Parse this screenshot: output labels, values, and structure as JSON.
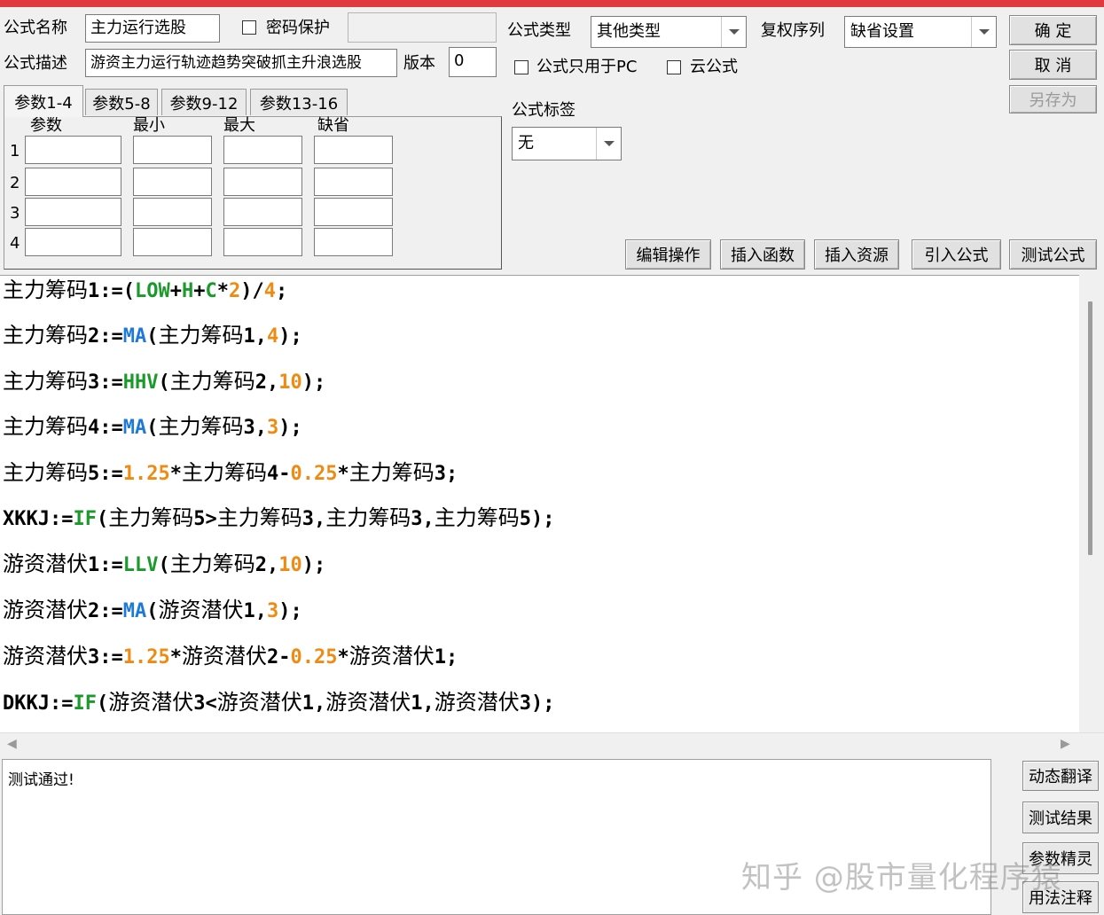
{
  "form": {
    "name_label": "公式名称",
    "name_value": "主力运行选股",
    "password_label": "密码保护",
    "desc_label": "公式描述",
    "desc_value": "游资主力运行轨迹趋势突破抓主升浪选股",
    "version_label": "版本",
    "version_value": "0",
    "type_label": "公式类型",
    "type_value": "其他类型",
    "rights_label": "复权序列",
    "rights_value": "缺省设置",
    "pc_only_label": "公式只用于PC",
    "cloud_label": "云公式",
    "tag_label": "公式标签",
    "tag_value": "无"
  },
  "buttons": {
    "ok": "确  定",
    "cancel": "取  消",
    "save_as": "另存为",
    "edit_ops": "编辑操作",
    "insert_func": "插入函数",
    "insert_res": "插入资源",
    "import_formula": "引入公式",
    "test_formula": "测试公式"
  },
  "tabs": [
    "参数1-4",
    "参数5-8",
    "参数9-12",
    "参数13-16"
  ],
  "param_headers": [
    "参数",
    "最小",
    "最大",
    "缺省"
  ],
  "param_rows": [
    "1",
    "2",
    "3",
    "4"
  ],
  "code_lines": [
    [
      {
        "t": "主力筹码",
        "c": "cn"
      },
      {
        "t": "1:=(",
        "c": "tok-id"
      },
      {
        "t": "LOW",
        "c": "tok-fn-green"
      },
      {
        "t": "+",
        "c": "tok-id"
      },
      {
        "t": "H",
        "c": "tok-fn-green"
      },
      {
        "t": "+",
        "c": "tok-id"
      },
      {
        "t": "C",
        "c": "tok-fn-green"
      },
      {
        "t": "*",
        "c": "tok-id"
      },
      {
        "t": "2",
        "c": "tok-num"
      },
      {
        "t": ")/",
        "c": "tok-id"
      },
      {
        "t": "4",
        "c": "tok-num"
      },
      {
        "t": ";",
        "c": "tok-id"
      }
    ],
    [
      {
        "t": "主力筹码",
        "c": "cn"
      },
      {
        "t": "2:=",
        "c": "tok-id"
      },
      {
        "t": "MA",
        "c": "tok-fn-blue"
      },
      {
        "t": "(",
        "c": "tok-id"
      },
      {
        "t": "主力筹码",
        "c": "cn"
      },
      {
        "t": "1,",
        "c": "tok-id"
      },
      {
        "t": "4",
        "c": "tok-num"
      },
      {
        "t": ");",
        "c": "tok-id"
      }
    ],
    [
      {
        "t": "主力筹码",
        "c": "cn"
      },
      {
        "t": "3:=",
        "c": "tok-id"
      },
      {
        "t": "HHV",
        "c": "tok-fn-green"
      },
      {
        "t": "(",
        "c": "tok-id"
      },
      {
        "t": "主力筹码",
        "c": "cn"
      },
      {
        "t": "2,",
        "c": "tok-id"
      },
      {
        "t": "10",
        "c": "tok-num"
      },
      {
        "t": ");",
        "c": "tok-id"
      }
    ],
    [
      {
        "t": "主力筹码",
        "c": "cn"
      },
      {
        "t": "4:=",
        "c": "tok-id"
      },
      {
        "t": "MA",
        "c": "tok-fn-blue"
      },
      {
        "t": "(",
        "c": "tok-id"
      },
      {
        "t": "主力筹码",
        "c": "cn"
      },
      {
        "t": "3,",
        "c": "tok-id"
      },
      {
        "t": "3",
        "c": "tok-num"
      },
      {
        "t": ");",
        "c": "tok-id"
      }
    ],
    [
      {
        "t": "主力筹码",
        "c": "cn"
      },
      {
        "t": "5:=",
        "c": "tok-id"
      },
      {
        "t": "1.25",
        "c": "tok-num"
      },
      {
        "t": "*",
        "c": "tok-id"
      },
      {
        "t": "主力筹码",
        "c": "cn"
      },
      {
        "t": "4-",
        "c": "tok-id"
      },
      {
        "t": "0.25",
        "c": "tok-num"
      },
      {
        "t": "*",
        "c": "tok-id"
      },
      {
        "t": "主力筹码",
        "c": "cn"
      },
      {
        "t": "3;",
        "c": "tok-id"
      }
    ],
    [
      {
        "t": "XKKJ:=",
        "c": "tok-id"
      },
      {
        "t": "IF",
        "c": "tok-fn-green"
      },
      {
        "t": "(",
        "c": "tok-id"
      },
      {
        "t": "主力筹码",
        "c": "cn"
      },
      {
        "t": "5>",
        "c": "tok-id"
      },
      {
        "t": "主力筹码",
        "c": "cn"
      },
      {
        "t": "3,",
        "c": "tok-id"
      },
      {
        "t": "主力筹码",
        "c": "cn"
      },
      {
        "t": "3,",
        "c": "tok-id"
      },
      {
        "t": "主力筹码",
        "c": "cn"
      },
      {
        "t": "5);",
        "c": "tok-id"
      }
    ],
    [
      {
        "t": "游资潜伏",
        "c": "cn"
      },
      {
        "t": "1:=",
        "c": "tok-id"
      },
      {
        "t": "LLV",
        "c": "tok-fn-green"
      },
      {
        "t": "(",
        "c": "tok-id"
      },
      {
        "t": "主力筹码",
        "c": "cn"
      },
      {
        "t": "2,",
        "c": "tok-id"
      },
      {
        "t": "10",
        "c": "tok-num"
      },
      {
        "t": ");",
        "c": "tok-id"
      }
    ],
    [
      {
        "t": "游资潜伏",
        "c": "cn"
      },
      {
        "t": "2:=",
        "c": "tok-id"
      },
      {
        "t": "MA",
        "c": "tok-fn-blue"
      },
      {
        "t": "(",
        "c": "tok-id"
      },
      {
        "t": "游资潜伏",
        "c": "cn"
      },
      {
        "t": "1,",
        "c": "tok-id"
      },
      {
        "t": "3",
        "c": "tok-num"
      },
      {
        "t": ");",
        "c": "tok-id"
      }
    ],
    [
      {
        "t": "游资潜伏",
        "c": "cn"
      },
      {
        "t": "3:=",
        "c": "tok-id"
      },
      {
        "t": "1.25",
        "c": "tok-num"
      },
      {
        "t": "*",
        "c": "tok-id"
      },
      {
        "t": "游资潜伏",
        "c": "cn"
      },
      {
        "t": "2-",
        "c": "tok-id"
      },
      {
        "t": "0.25",
        "c": "tok-num"
      },
      {
        "t": "*",
        "c": "tok-id"
      },
      {
        "t": "游资潜伏",
        "c": "cn"
      },
      {
        "t": "1;",
        "c": "tok-id"
      }
    ],
    [
      {
        "t": "DKKJ:=",
        "c": "tok-id"
      },
      {
        "t": "IF",
        "c": "tok-fn-green"
      },
      {
        "t": "(",
        "c": "tok-id"
      },
      {
        "t": "游资潜伏",
        "c": "cn"
      },
      {
        "t": "3<",
        "c": "tok-id"
      },
      {
        "t": "游资潜伏",
        "c": "cn"
      },
      {
        "t": "1,",
        "c": "tok-id"
      },
      {
        "t": "游资潜伏",
        "c": "cn"
      },
      {
        "t": "1,",
        "c": "tok-id"
      },
      {
        "t": "游资潜伏",
        "c": "cn"
      },
      {
        "t": "3);",
        "c": "tok-id"
      }
    ]
  ],
  "output": {
    "text": "测试通过!"
  },
  "side_buttons": [
    "动态翻译",
    "测试结果",
    "参数精灵",
    "用法注释"
  ],
  "watermark": "知乎 @股市量化程序猿",
  "icons": {
    "dropdown": "chevron-down-icon",
    "scroll_left": "arrow-left-icon",
    "scroll_right": "arrow-right-icon"
  }
}
